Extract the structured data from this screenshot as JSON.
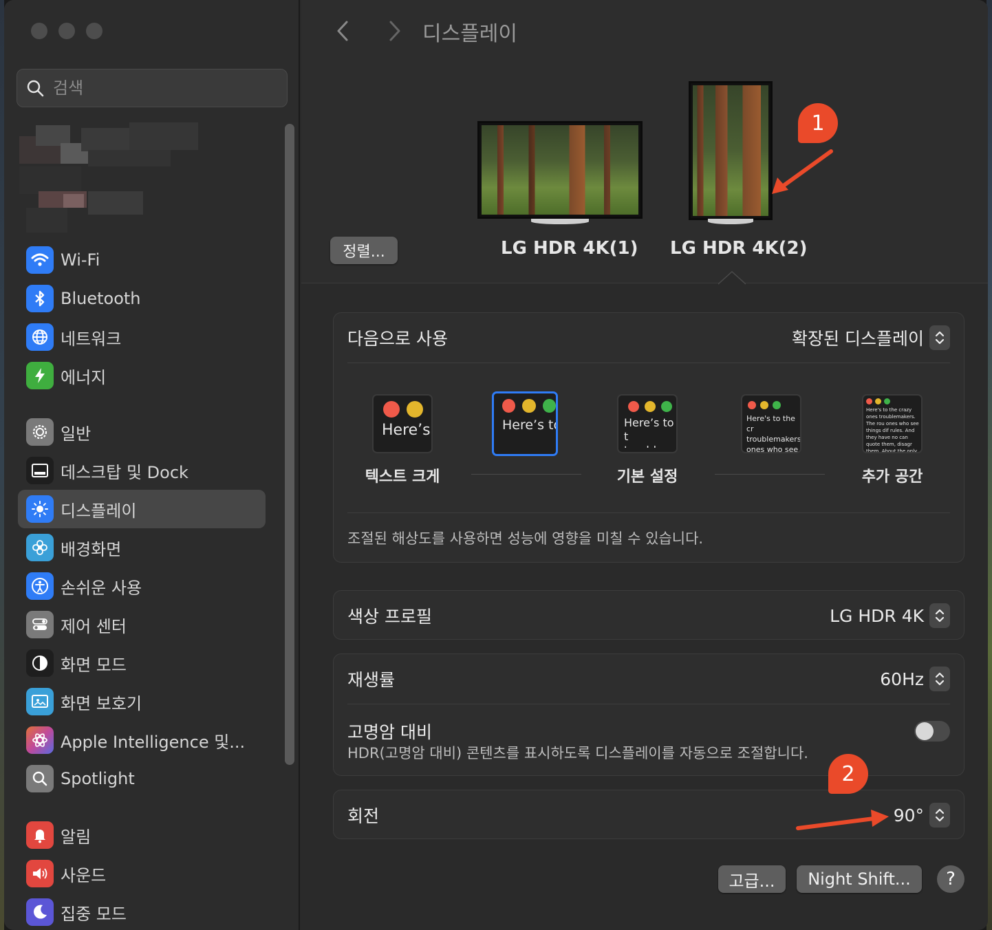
{
  "sidebar": {
    "search_placeholder": "검색",
    "items": [
      {
        "label": "Wi-Fi",
        "icon": "wifi-icon",
        "color": "#2f7cf6"
      },
      {
        "label": "Bluetooth",
        "icon": "bluetooth-icon",
        "color": "#2f7cf6"
      },
      {
        "label": "네트워크",
        "icon": "globe-icon",
        "color": "#2f7cf6"
      },
      {
        "label": "에너지",
        "icon": "bolt-icon",
        "color": "#3fae3f"
      },
      {
        "label": "일반",
        "icon": "gear-icon",
        "color": "#7a7a7a"
      },
      {
        "label": "데스크탑 및 Dock",
        "icon": "dock-icon",
        "color": "#1e1e1e"
      },
      {
        "label": "디스플레이",
        "icon": "sun-icon",
        "color": "#2f7cf6"
      },
      {
        "label": "배경화면",
        "icon": "flower-icon",
        "color": "#3aa0d8"
      },
      {
        "label": "손쉬운 사용",
        "icon": "accessibility-icon",
        "color": "#2f7cf6"
      },
      {
        "label": "제어 센터",
        "icon": "switches-icon",
        "color": "#7a7a7a"
      },
      {
        "label": "화면 모드",
        "icon": "appearance-icon",
        "color": "#1e1e1e"
      },
      {
        "label": "화면 보호기",
        "icon": "screensaver-icon",
        "color": "#3aa0d8"
      },
      {
        "label": "Apple Intelligence 및...",
        "icon": "intelligence-icon",
        "color": "#c04a9a"
      },
      {
        "label": "Spotlight",
        "icon": "magnifier-icon",
        "color": "#7a7a7a"
      },
      {
        "label": "알림",
        "icon": "bell-icon",
        "color": "#e2473f"
      },
      {
        "label": "사운드",
        "icon": "speaker-icon",
        "color": "#e2473f"
      },
      {
        "label": "집중 모드",
        "icon": "moon-icon",
        "color": "#5b56d6"
      }
    ]
  },
  "main": {
    "title": "디스플레이",
    "arrange_label": "정렬...",
    "monitors": [
      {
        "label": "LG HDR 4K(1)"
      },
      {
        "label": "LG HDR 4K(2)"
      }
    ],
    "use_as": {
      "label": "다음으로 사용",
      "value": "확장된 디스플레이"
    },
    "resolution": {
      "options": [
        {
          "caption": "텍스트 크게",
          "sample": "Here’s"
        },
        {
          "caption": "",
          "sample": "Here’s to troublem"
        },
        {
          "caption": "기본 설정",
          "sample": "Here’s to t troublema ones who"
        },
        {
          "caption": "",
          "sample": "Here's to the cr troublemakers. ones who see t rules. And they"
        },
        {
          "caption": "추가 공간",
          "sample": "Here's to the crazy ones troublemakers. The rou ones who see things dif rules. And they have no can quote them, disagr them. About the only th Because they change t"
        }
      ],
      "note": "조절된 해상도를 사용하면 성능에 영향을 미칠 수 있습니다."
    },
    "color_profile": {
      "label": "색상 프로필",
      "value": "LG HDR 4K"
    },
    "refresh_rate": {
      "label": "재생률",
      "value": "60Hz"
    },
    "hdr": {
      "label": "고명암 대비",
      "description": "HDR(고명암 대비) 콘텐츠를 표시하도록 디스플레이를 자동으로 조절합니다.",
      "enabled": false
    },
    "rotation": {
      "label": "회전",
      "value": "90°"
    },
    "buttons": {
      "advanced": "고급...",
      "night_shift": "Night Shift...",
      "help": "?"
    }
  },
  "annotations": {
    "badge1": "1",
    "badge2": "2",
    "color": "#ea4a2a"
  }
}
